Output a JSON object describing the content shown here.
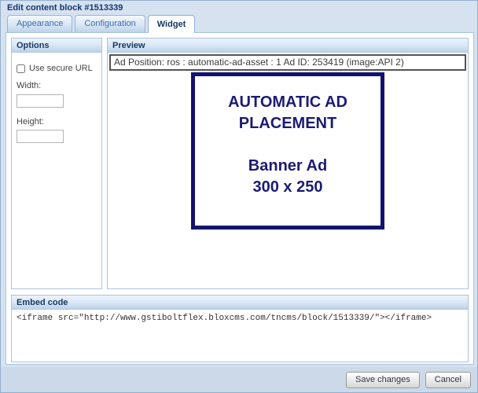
{
  "window": {
    "title": "Edit content block #1513339"
  },
  "tabs": [
    {
      "label": "Appearance",
      "active": false
    },
    {
      "label": "Configuration",
      "active": false
    },
    {
      "label": "Widget",
      "active": true
    }
  ],
  "options": {
    "header": "Options",
    "secure_url_label": "Use secure URL",
    "secure_url_checked": false,
    "width_label": "Width:",
    "width_value": "",
    "height_label": "Height:",
    "height_value": ""
  },
  "preview": {
    "header": "Preview",
    "ad_position_text": "Ad Position: ros : automatic-ad-asset : 1 Ad ID: 253419 (image:API 2)",
    "banner": {
      "title": "AUTOMATIC AD PLACEMENT",
      "line2": "Banner Ad",
      "line3": "300 x 250",
      "border_color": "#13136e",
      "text_color": "#1b1b75"
    }
  },
  "embed": {
    "header": "Embed code",
    "code": "<iframe src=\"http://www.gstiboltflex.bloxcms.com/tncms/block/1513339/\"></iframe>"
  },
  "footer": {
    "save_label": "Save changes",
    "cancel_label": "Cancel"
  },
  "colors": {
    "window_background": "#d6e2f0",
    "panel_border": "#a9c3e0",
    "header_text": "#163a66",
    "tab_inactive_text": "#3a6da9",
    "footer_background": "#ccd9e9"
  }
}
